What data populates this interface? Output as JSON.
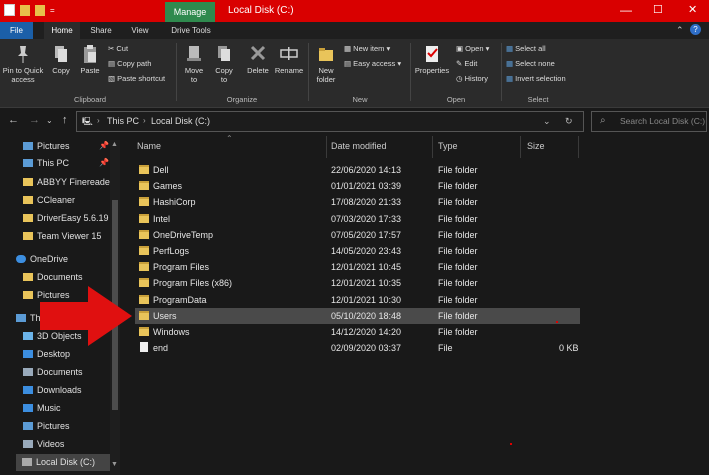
{
  "window": {
    "title": "Local Disk (C:)",
    "context_tab": "Manage",
    "controls": {
      "minimize": "—",
      "maximize": "☐",
      "close": "✕"
    }
  },
  "ribbon_tabs": [
    {
      "label": "File"
    },
    {
      "label": "Home"
    },
    {
      "label": "Share"
    },
    {
      "label": "View"
    },
    {
      "label": "Drive Tools"
    }
  ],
  "ribbon": {
    "clipboard": {
      "group": "Clipboard",
      "pin": "Pin to Quick access",
      "copy": "Copy",
      "paste": "Paste",
      "cut": "Cut",
      "copy_path": "Copy path",
      "paste_shortcut": "Paste shortcut"
    },
    "organize": {
      "group": "Organize",
      "move_to": "Move to",
      "copy_to": "Copy to",
      "delete": "Delete",
      "rename": "Rename"
    },
    "new": {
      "group": "New",
      "new_folder": "New folder",
      "new_item": "New item",
      "easy_access": "Easy access"
    },
    "open": {
      "group": "Open",
      "properties": "Properties",
      "open": "Open",
      "edit": "Edit",
      "history": "History"
    },
    "select": {
      "group": "Select",
      "select_all": "Select all",
      "select_none": "Select none",
      "invert": "Invert selection"
    }
  },
  "address": {
    "crumbs": [
      "This PC",
      "Local Disk (C:)"
    ],
    "search_placeholder": "Search Local Disk (C:)"
  },
  "nav": [
    {
      "label": "Pictures",
      "icon": "pictures-icon",
      "pinned": true
    },
    {
      "label": "This PC",
      "icon": "pc-icon",
      "pinned": true
    },
    {
      "label": "ABBYY Finereader",
      "icon": "folder-icon"
    },
    {
      "label": "CCleaner",
      "icon": "folder-icon"
    },
    {
      "label": "DriverEasy 5.6.19",
      "icon": "folder-icon"
    },
    {
      "label": "Team Viewer 15",
      "icon": "folder-icon"
    },
    {
      "label": "OneDrive",
      "icon": "cloud-icon"
    },
    {
      "label": "Documents",
      "icon": "folder-icon"
    },
    {
      "label": "Pictures",
      "icon": "folder-icon"
    },
    {
      "label": "This PC",
      "icon": "pc-icon"
    },
    {
      "label": "3D Objects",
      "icon": "3d-objects-icon"
    },
    {
      "label": "Desktop",
      "icon": "desktop-icon"
    },
    {
      "label": "Documents",
      "icon": "documents-icon"
    },
    {
      "label": "Downloads",
      "icon": "downloads-icon"
    },
    {
      "label": "Music",
      "icon": "music-icon"
    },
    {
      "label": "Pictures",
      "icon": "pictures-icon"
    },
    {
      "label": "Videos",
      "icon": "videos-icon"
    },
    {
      "label": "Local Disk (C:)",
      "icon": "drive-icon",
      "selected": true
    }
  ],
  "columns": [
    "Name",
    "Date modified",
    "Type",
    "Size"
  ],
  "files": [
    {
      "name": "Dell",
      "date": "22/06/2020 14:13",
      "type": "File folder",
      "size": ""
    },
    {
      "name": "Games",
      "date": "01/01/2021 03:39",
      "type": "File folder",
      "size": ""
    },
    {
      "name": "HashiCorp",
      "date": "17/08/2020 21:33",
      "type": "File folder",
      "size": ""
    },
    {
      "name": "Intel",
      "date": "07/03/2020 17:33",
      "type": "File folder",
      "size": ""
    },
    {
      "name": "OneDriveTemp",
      "date": "07/05/2020 17:57",
      "type": "File folder",
      "size": ""
    },
    {
      "name": "PerfLogs",
      "date": "14/05/2020 23:43",
      "type": "File folder",
      "size": ""
    },
    {
      "name": "Program Files",
      "date": "12/01/2021 10:45",
      "type": "File folder",
      "size": ""
    },
    {
      "name": "Program Files (x86)",
      "date": "12/01/2021 10:35",
      "type": "File folder",
      "size": ""
    },
    {
      "name": "ProgramData",
      "date": "12/01/2021 10:30",
      "type": "File folder",
      "size": ""
    },
    {
      "name": "Users",
      "date": "05/10/2020 18:48",
      "type": "File folder",
      "size": "",
      "selected": true
    },
    {
      "name": "Windows",
      "date": "14/12/2020 14:20",
      "type": "File folder",
      "size": ""
    },
    {
      "name": "end",
      "date": "02/09/2020 03:37",
      "type": "File",
      "size": "0 KB"
    }
  ],
  "colors": {
    "titlebar": "#d90000",
    "manage": "#2f8a4e",
    "file_tab": "#1b5fa8",
    "folder": "#e9c45a",
    "arrow": "#e01010"
  }
}
